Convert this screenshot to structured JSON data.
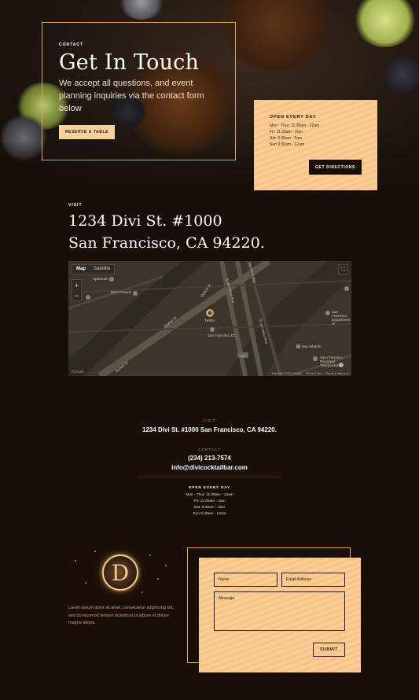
{
  "hero": {
    "eyebrow": "CONTACT",
    "title": "Get In Touch",
    "subtitle": "We accept all questions, and event planning inquiries via the contact form below",
    "cta_label": "RESERVE A TABLE"
  },
  "hours_card": {
    "title": "OPEN EVERY DAY",
    "lines": [
      "Mon - Thur: 11:30am - 12am",
      "Fri: 11:30am - 2am",
      "Sat: 9:30am - 2am",
      "Sun 9:30am - 12am"
    ],
    "directions_label": "GET DIRECTIONS"
  },
  "visit": {
    "eyebrow": "VISIT",
    "address_line1": "1234 Divi St. #1000",
    "address_line2": "San Francisco, CA 94220."
  },
  "map": {
    "map_label": "Map",
    "satellite_label": "Satellite",
    "zoom_in": "+",
    "zoom_out": "−",
    "fullscreen": "⛶",
    "labels": {
      "splitsecond": "Splitseam",
      "bis_flowers": "Bis's Flowers",
      "market_st_1": "Market St",
      "market_st_2": "Market St",
      "market_st_3": "Market St",
      "van_ness_1": "S Van Ness Ave",
      "van_ness_2": "Van Ness Ave",
      "van_ness_3": "S Van Ness Ave",
      "twitter": "Twitter",
      "sf_dc": "San Francisco DC",
      "sf_transport": "San Francisco Department of",
      "bay_wheels": "Bay Wheels",
      "sf_mta": "San Francisco Municipal Transportation",
      "hwy": "101"
    },
    "footer": [
      "Map data ©2019 Google",
      "Terms of Use",
      "Report a map error"
    ],
    "google": "Google"
  },
  "contact_info": {
    "visit_eyebrow": "VISIT",
    "address": "1234 Divi St. #1000 San Francisco, CA 94220.",
    "contact_eyebrow": "CONTACT",
    "phone": "(234) 213-7574",
    "email": "info@divicocktailbar.com",
    "hours_title": "OPEN EVERY DAY",
    "hours": [
      "Mon - Thur: 11:30am - 12am",
      "Fri: 11:30am - 2am",
      "Sat: 9:30am - 2am",
      "Sun 9:30am - 12am"
    ]
  },
  "footer": {
    "logo_letter": "D",
    "lorem": "Lorem ipsum dolor sit amet, consectetur adipiscing elit, sed do eiusmod tempor incididunt ut labore et dolore magna aliqua."
  },
  "form": {
    "name_placeholder": "Name",
    "email_placeholder": "Email Address",
    "message_placeholder": "Message",
    "submit_label": "SUBMIT"
  },
  "colors": {
    "accent": "#fcc98c",
    "background": "#1a0e08",
    "outline": "#d9a56a"
  }
}
